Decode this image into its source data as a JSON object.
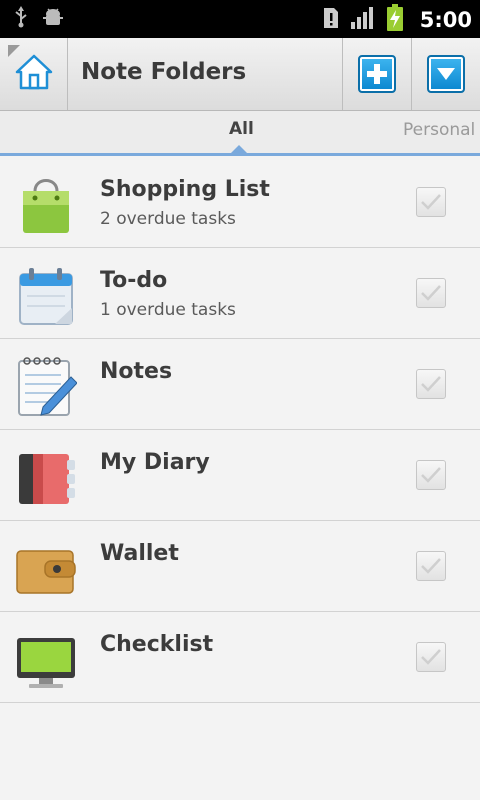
{
  "status_bar": {
    "time": "5:00",
    "icons": [
      "usb-icon",
      "android-debug-icon",
      "alert-icon",
      "signal-icon",
      "battery-charging-icon"
    ]
  },
  "action_bar": {
    "title": "Note Folders",
    "home_icon": "home-icon",
    "add_icon": "add-icon",
    "menu_icon": "dropdown-icon"
  },
  "tabs": [
    {
      "label": "All",
      "selected": true
    },
    {
      "label": "Personal",
      "selected": false
    }
  ],
  "folders": [
    {
      "name": "Shopping List",
      "subtitle": "2 overdue tasks",
      "icon": "shopping-bag-icon",
      "checked": true
    },
    {
      "name": "To-do",
      "subtitle": "1 overdue tasks",
      "icon": "calendar-icon",
      "checked": true
    },
    {
      "name": "Notes",
      "subtitle": "",
      "icon": "notepad-icon",
      "checked": true
    },
    {
      "name": "My Diary",
      "subtitle": "",
      "icon": "diary-icon",
      "checked": true
    },
    {
      "name": "Wallet",
      "subtitle": "",
      "icon": "wallet-icon",
      "checked": true
    },
    {
      "name": "Checklist",
      "subtitle": "",
      "icon": "monitor-icon",
      "checked": true
    }
  ],
  "colors": {
    "accent": "#7aa9dc",
    "button_blue": "#0a86cf"
  }
}
